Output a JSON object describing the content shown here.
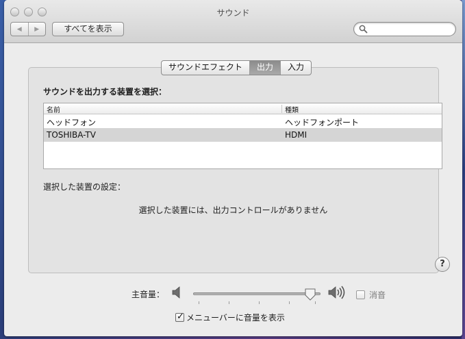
{
  "window": {
    "title": "サウンド"
  },
  "toolbar": {
    "back_icon": "◀",
    "forward_icon": "▶",
    "show_all_label": "すべてを表示",
    "search": {
      "value": "",
      "placeholder": ""
    }
  },
  "tabs": [
    {
      "label": "サウンドエフェクト",
      "active": false
    },
    {
      "label": "出力",
      "active": true
    },
    {
      "label": "入力",
      "active": false
    }
  ],
  "output": {
    "section_label": "サウンドを出力する装置を選択：",
    "columns": [
      "名前",
      "種類"
    ],
    "devices": [
      {
        "name": "ヘッドフォン",
        "type": "ヘッドフォンポート",
        "selected": false
      },
      {
        "name": "TOSHIBA-TV",
        "type": "HDMI",
        "selected": true
      }
    ],
    "settings_label": "選択した装置の設定：",
    "no_controls_text": "選択した装置には、出力コントロールがありません"
  },
  "help": {
    "label": "?"
  },
  "volume": {
    "label": "主音量：",
    "level": 0.96,
    "mute_label": "消音",
    "mute_checked": false
  },
  "menubar_option": {
    "label": "メニューバーに音量を表示",
    "checked": true,
    "check_glyph": "✓"
  }
}
